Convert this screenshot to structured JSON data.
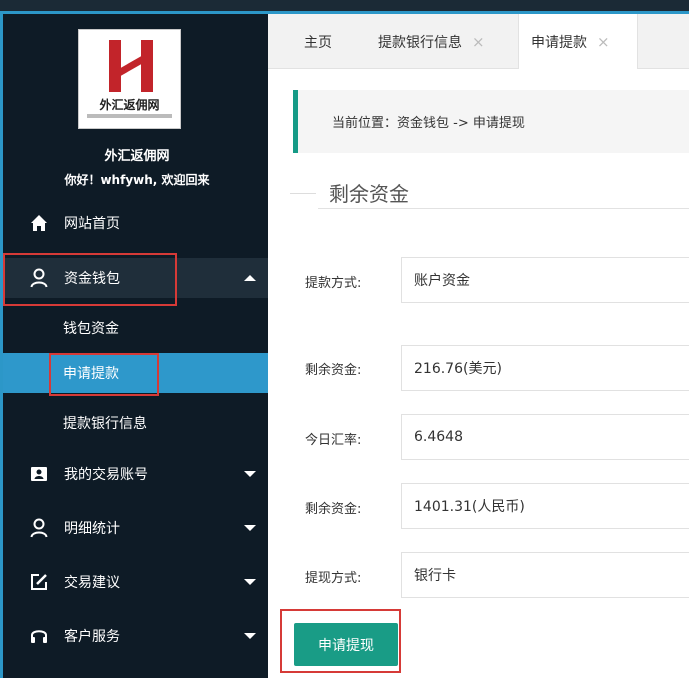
{
  "colors": {
    "sidebar_bg": "#0e1b26",
    "accent_blue": "#2e98cb",
    "accent_green": "#199c86",
    "highlight_red": "#d63a37"
  },
  "logo": {
    "text": "外汇返佣网"
  },
  "sidebar": {
    "site_name": "外汇返佣网",
    "greeting": "你好！whfywh, 欢迎回来",
    "items": [
      {
        "label": "网站首页",
        "icon": "home-icon"
      },
      {
        "label": "资金钱包",
        "icon": "user-icon",
        "expanded": true,
        "children": [
          {
            "label": "钱包资金"
          },
          {
            "label": "申请提款",
            "selected": true
          },
          {
            "label": "提款银行信息"
          }
        ]
      },
      {
        "label": "我的交易账号",
        "icon": "id-card-icon"
      },
      {
        "label": "明细统计",
        "icon": "user-icon"
      },
      {
        "label": "交易建议",
        "icon": "edit-icon"
      },
      {
        "label": "客户服务",
        "icon": "headset-icon"
      }
    ]
  },
  "tabs": [
    {
      "label": "主页",
      "closable": false
    },
    {
      "label": "提款银行信息",
      "closable": true
    },
    {
      "label": "申请提款",
      "closable": true,
      "active": true
    }
  ],
  "tab_close_glyph": "×",
  "breadcrumb": "当前位置：资金钱包 -> 申请提现",
  "section_title": "剩余资金",
  "form": {
    "fields": [
      {
        "label": "提款方式:",
        "value": "账户资金"
      },
      {
        "label": "剩余资金:",
        "value": "216.76(美元)"
      },
      {
        "label": "今日汇率:",
        "value": "6.4648"
      },
      {
        "label": "剩余资金:",
        "value": "1401.31(人民币)"
      },
      {
        "label": "提现方式:",
        "value": "银行卡"
      }
    ],
    "submit_label": "申请提现"
  }
}
